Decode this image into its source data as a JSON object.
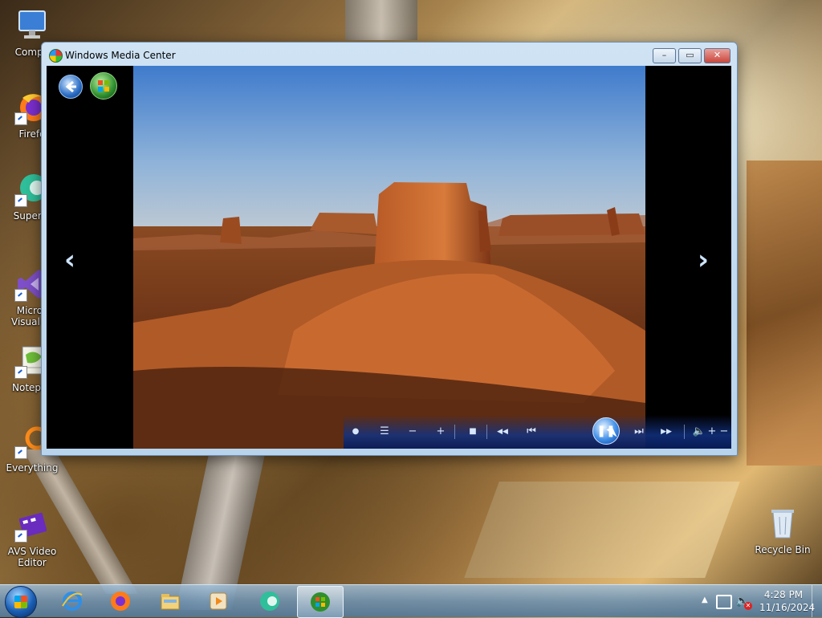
{
  "desktop": {
    "icons": [
      {
        "label": "Compu",
        "icon": "computer-icon"
      },
      {
        "label": "Firefo",
        "icon": "firefox-icon"
      },
      {
        "label": "Superm",
        "icon": "supermium-icon"
      },
      {
        "label": "Micros Visual St",
        "icon": "visual-studio-icon"
      },
      {
        "label": "Notepac",
        "icon": "notepad-plus-plus-icon"
      },
      {
        "label": "Everything",
        "icon": "everything-search-icon"
      },
      {
        "label": "AVS Video Editor",
        "icon": "avs-video-editor-icon"
      },
      {
        "label": "Recycle Bin",
        "icon": "recycle-bin-icon"
      }
    ]
  },
  "window": {
    "title": "Windows Media Center",
    "buttons": {
      "minimize": "–",
      "restore": "▭",
      "close": "✕"
    }
  },
  "media_center": {
    "nav": {
      "back": "back-arrow-icon",
      "start": "media-center-start-icon",
      "previous": "‹",
      "next": "›"
    },
    "photo": {
      "subject": "desert-butte-photo"
    },
    "controls": {
      "record": "●",
      "guide": "☰",
      "channel_down": "−",
      "channel_up": "+",
      "stop": "■",
      "rewind": "◀◀",
      "skip_back": "⏮",
      "pause": "❚❚",
      "skip_forward": "⏭",
      "fast_forward": "▶▶",
      "mute": "🔈",
      "volume_down": "−",
      "volume_up": "+"
    }
  },
  "taskbar": {
    "pinned": [
      "internet-explorer-icon",
      "firefox-icon",
      "file-explorer-icon",
      "media-player-icon",
      "supermium-icon",
      "windows-media-center-icon"
    ],
    "active_item": "windows-media-center-icon",
    "tray": {
      "overflow_arrow": "▲",
      "time": "4:28 PM",
      "date": "11/16/2024"
    }
  },
  "colors": {
    "window_frame": "#b8d3ec",
    "media_bg": "#000000",
    "control_bar": "#12328a",
    "taskbar": "#6e91af"
  }
}
